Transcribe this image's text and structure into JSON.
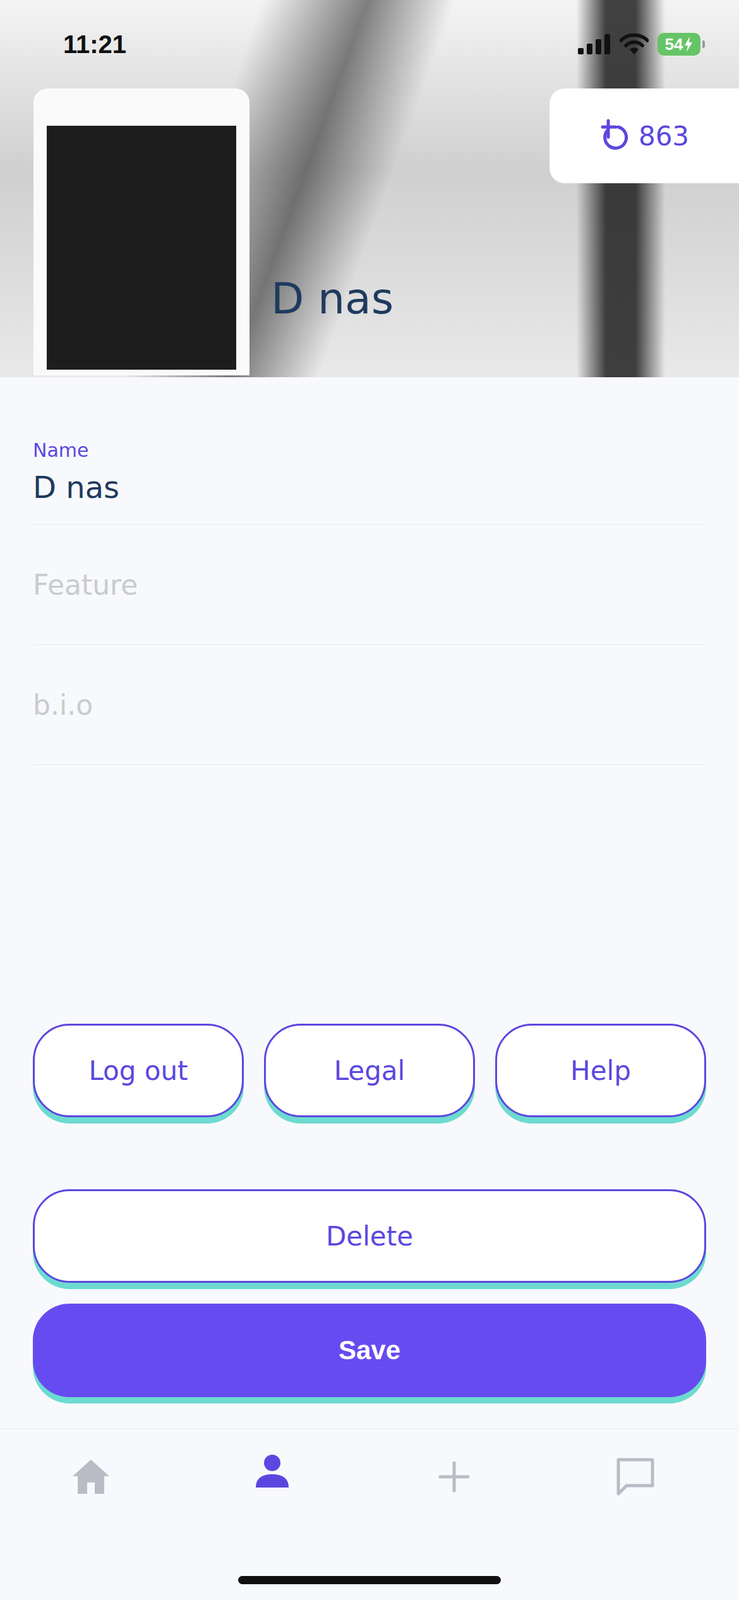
{
  "status_bar": {
    "time": "11:21",
    "battery": "54",
    "charging": true
  },
  "header": {
    "name": "D nas",
    "coins": "863"
  },
  "form": {
    "fields": [
      {
        "kind": "filled",
        "label": "Name",
        "value": "D nas",
        "placeholder": ""
      },
      {
        "kind": "empty",
        "label": "",
        "value": "",
        "placeholder": "Feature"
      },
      {
        "kind": "empty",
        "label": "",
        "value": "",
        "placeholder": "b.i.o"
      }
    ]
  },
  "actions": [
    "Log out",
    "Legal",
    "Help"
  ],
  "delete_button": "Delete",
  "save_button": "Save",
  "nav": [
    {
      "kind": "home",
      "selected": false
    },
    {
      "kind": "profile",
      "selected": true
    },
    {
      "kind": "create",
      "selected": false
    },
    {
      "kind": "messages",
      "selected": false
    }
  ]
}
